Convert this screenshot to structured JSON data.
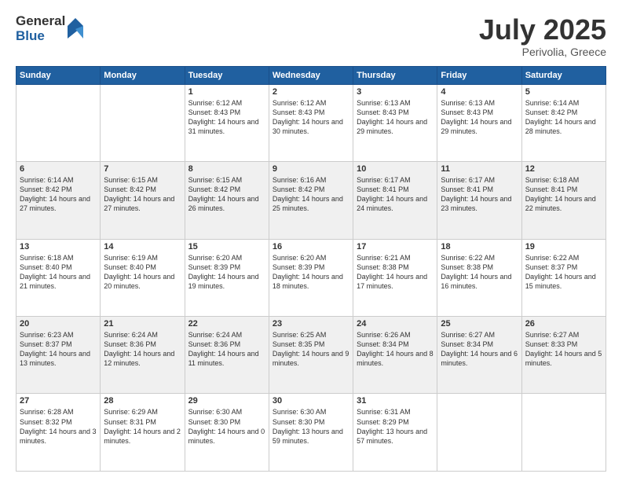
{
  "logo": {
    "general": "General",
    "blue": "Blue"
  },
  "title": {
    "month": "July 2025",
    "location": "Perivolia, Greece"
  },
  "days_header": [
    "Sunday",
    "Monday",
    "Tuesday",
    "Wednesday",
    "Thursday",
    "Friday",
    "Saturday"
  ],
  "weeks": [
    [
      {
        "day": "",
        "sunrise": "",
        "sunset": "",
        "daylight": ""
      },
      {
        "day": "",
        "sunrise": "",
        "sunset": "",
        "daylight": ""
      },
      {
        "day": "1",
        "sunrise": "Sunrise: 6:12 AM",
        "sunset": "Sunset: 8:43 PM",
        "daylight": "Daylight: 14 hours and 31 minutes."
      },
      {
        "day": "2",
        "sunrise": "Sunrise: 6:12 AM",
        "sunset": "Sunset: 8:43 PM",
        "daylight": "Daylight: 14 hours and 30 minutes."
      },
      {
        "day": "3",
        "sunrise": "Sunrise: 6:13 AM",
        "sunset": "Sunset: 8:43 PM",
        "daylight": "Daylight: 14 hours and 29 minutes."
      },
      {
        "day": "4",
        "sunrise": "Sunrise: 6:13 AM",
        "sunset": "Sunset: 8:43 PM",
        "daylight": "Daylight: 14 hours and 29 minutes."
      },
      {
        "day": "5",
        "sunrise": "Sunrise: 6:14 AM",
        "sunset": "Sunset: 8:42 PM",
        "daylight": "Daylight: 14 hours and 28 minutes."
      }
    ],
    [
      {
        "day": "6",
        "sunrise": "Sunrise: 6:14 AM",
        "sunset": "Sunset: 8:42 PM",
        "daylight": "Daylight: 14 hours and 27 minutes."
      },
      {
        "day": "7",
        "sunrise": "Sunrise: 6:15 AM",
        "sunset": "Sunset: 8:42 PM",
        "daylight": "Daylight: 14 hours and 27 minutes."
      },
      {
        "day": "8",
        "sunrise": "Sunrise: 6:15 AM",
        "sunset": "Sunset: 8:42 PM",
        "daylight": "Daylight: 14 hours and 26 minutes."
      },
      {
        "day": "9",
        "sunrise": "Sunrise: 6:16 AM",
        "sunset": "Sunset: 8:42 PM",
        "daylight": "Daylight: 14 hours and 25 minutes."
      },
      {
        "day": "10",
        "sunrise": "Sunrise: 6:17 AM",
        "sunset": "Sunset: 8:41 PM",
        "daylight": "Daylight: 14 hours and 24 minutes."
      },
      {
        "day": "11",
        "sunrise": "Sunrise: 6:17 AM",
        "sunset": "Sunset: 8:41 PM",
        "daylight": "Daylight: 14 hours and 23 minutes."
      },
      {
        "day": "12",
        "sunrise": "Sunrise: 6:18 AM",
        "sunset": "Sunset: 8:41 PM",
        "daylight": "Daylight: 14 hours and 22 minutes."
      }
    ],
    [
      {
        "day": "13",
        "sunrise": "Sunrise: 6:18 AM",
        "sunset": "Sunset: 8:40 PM",
        "daylight": "Daylight: 14 hours and 21 minutes."
      },
      {
        "day": "14",
        "sunrise": "Sunrise: 6:19 AM",
        "sunset": "Sunset: 8:40 PM",
        "daylight": "Daylight: 14 hours and 20 minutes."
      },
      {
        "day": "15",
        "sunrise": "Sunrise: 6:20 AM",
        "sunset": "Sunset: 8:39 PM",
        "daylight": "Daylight: 14 hours and 19 minutes."
      },
      {
        "day": "16",
        "sunrise": "Sunrise: 6:20 AM",
        "sunset": "Sunset: 8:39 PM",
        "daylight": "Daylight: 14 hours and 18 minutes."
      },
      {
        "day": "17",
        "sunrise": "Sunrise: 6:21 AM",
        "sunset": "Sunset: 8:38 PM",
        "daylight": "Daylight: 14 hours and 17 minutes."
      },
      {
        "day": "18",
        "sunrise": "Sunrise: 6:22 AM",
        "sunset": "Sunset: 8:38 PM",
        "daylight": "Daylight: 14 hours and 16 minutes."
      },
      {
        "day": "19",
        "sunrise": "Sunrise: 6:22 AM",
        "sunset": "Sunset: 8:37 PM",
        "daylight": "Daylight: 14 hours and 15 minutes."
      }
    ],
    [
      {
        "day": "20",
        "sunrise": "Sunrise: 6:23 AM",
        "sunset": "Sunset: 8:37 PM",
        "daylight": "Daylight: 14 hours and 13 minutes."
      },
      {
        "day": "21",
        "sunrise": "Sunrise: 6:24 AM",
        "sunset": "Sunset: 8:36 PM",
        "daylight": "Daylight: 14 hours and 12 minutes."
      },
      {
        "day": "22",
        "sunrise": "Sunrise: 6:24 AM",
        "sunset": "Sunset: 8:36 PM",
        "daylight": "Daylight: 14 hours and 11 minutes."
      },
      {
        "day": "23",
        "sunrise": "Sunrise: 6:25 AM",
        "sunset": "Sunset: 8:35 PM",
        "daylight": "Daylight: 14 hours and 9 minutes."
      },
      {
        "day": "24",
        "sunrise": "Sunrise: 6:26 AM",
        "sunset": "Sunset: 8:34 PM",
        "daylight": "Daylight: 14 hours and 8 minutes."
      },
      {
        "day": "25",
        "sunrise": "Sunrise: 6:27 AM",
        "sunset": "Sunset: 8:34 PM",
        "daylight": "Daylight: 14 hours and 6 minutes."
      },
      {
        "day": "26",
        "sunrise": "Sunrise: 6:27 AM",
        "sunset": "Sunset: 8:33 PM",
        "daylight": "Daylight: 14 hours and 5 minutes."
      }
    ],
    [
      {
        "day": "27",
        "sunrise": "Sunrise: 6:28 AM",
        "sunset": "Sunset: 8:32 PM",
        "daylight": "Daylight: 14 hours and 3 minutes."
      },
      {
        "day": "28",
        "sunrise": "Sunrise: 6:29 AM",
        "sunset": "Sunset: 8:31 PM",
        "daylight": "Daylight: 14 hours and 2 minutes."
      },
      {
        "day": "29",
        "sunrise": "Sunrise: 6:30 AM",
        "sunset": "Sunset: 8:30 PM",
        "daylight": "Daylight: 14 hours and 0 minutes."
      },
      {
        "day": "30",
        "sunrise": "Sunrise: 6:30 AM",
        "sunset": "Sunset: 8:30 PM",
        "daylight": "Daylight: 13 hours and 59 minutes."
      },
      {
        "day": "31",
        "sunrise": "Sunrise: 6:31 AM",
        "sunset": "Sunset: 8:29 PM",
        "daylight": "Daylight: 13 hours and 57 minutes."
      },
      {
        "day": "",
        "sunrise": "",
        "sunset": "",
        "daylight": ""
      },
      {
        "day": "",
        "sunrise": "",
        "sunset": "",
        "daylight": ""
      }
    ]
  ]
}
